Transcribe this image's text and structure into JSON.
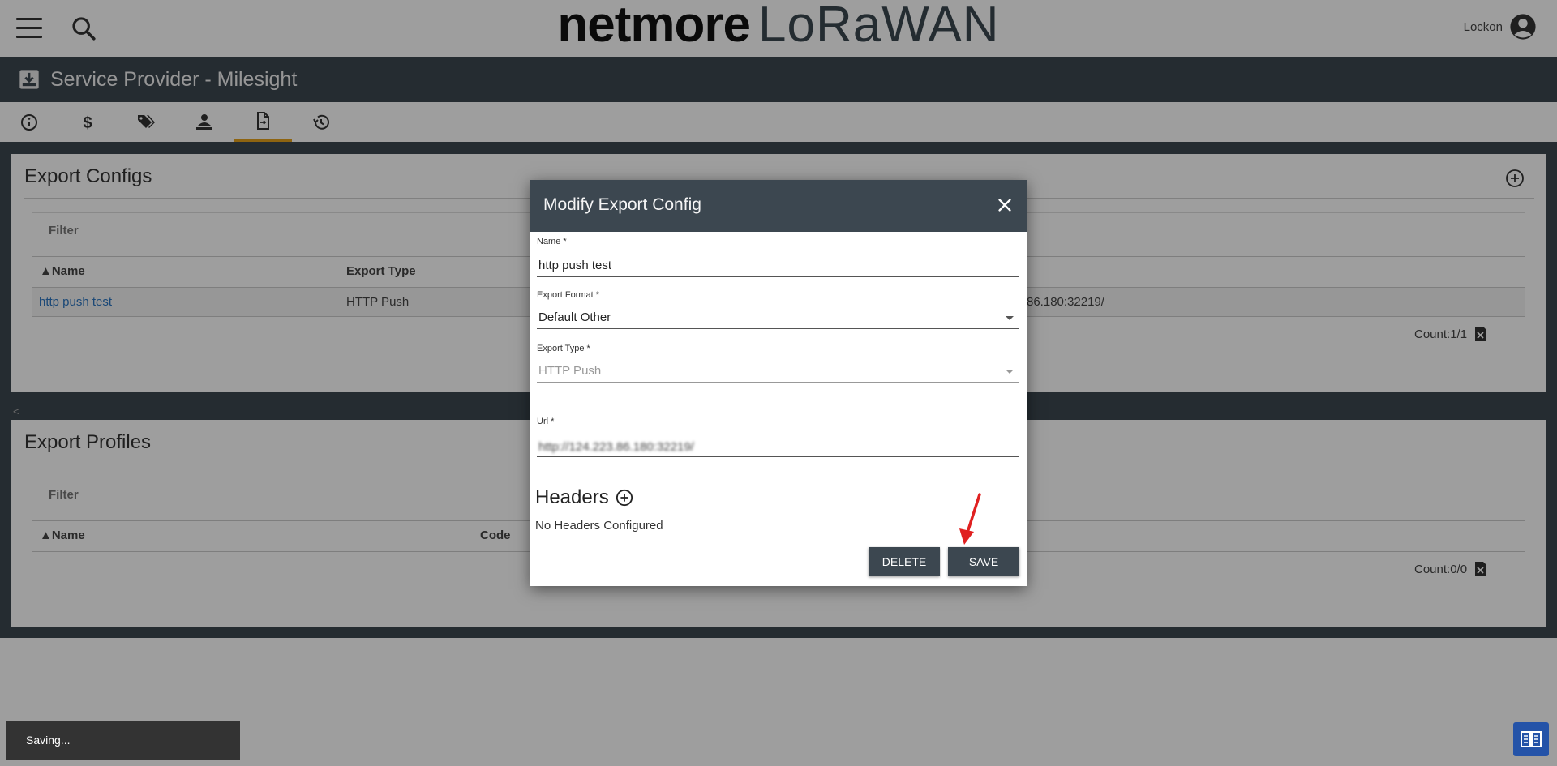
{
  "brand": {
    "part1": "netmore",
    "part2": "LoRaWAN"
  },
  "user": {
    "name": "Lockon"
  },
  "header": {
    "title": "Service Provider - Milesight"
  },
  "tabs": [
    {
      "icon": "info-icon"
    },
    {
      "icon": "dollar-icon"
    },
    {
      "icon": "tags-icon"
    },
    {
      "icon": "person-icon"
    },
    {
      "icon": "document-export-icon",
      "active": true
    },
    {
      "icon": "history-icon"
    }
  ],
  "export_configs": {
    "title": "Export Configs",
    "filter": "Filter",
    "columns": [
      "▲Name",
      "Export Type"
    ],
    "rows": [
      {
        "name": "http push test",
        "type": "HTTP Push",
        "url_tail": "86.180:32219/"
      }
    ],
    "count": "Count:1/1"
  },
  "export_profiles": {
    "title": "Export Profiles",
    "filter": "Filter",
    "columns": [
      "▲Name",
      "Code"
    ],
    "count": "Count:0/0"
  },
  "collapse_marker": "<",
  "modal": {
    "title": "Modify Export Config",
    "name_label": "Name *",
    "name_value": "http push test",
    "format_label": "Export Format *",
    "format_value": "Default Other",
    "type_label": "Export Type *",
    "type_value": "HTTP Push",
    "url_label": "Url *",
    "url_value": "http://124.223.86.180:32219/",
    "headers_title": "Headers",
    "no_headers": "No Headers Configured",
    "delete_label": "DELETE",
    "save_label": "SAVE"
  },
  "snackbar": {
    "text": "Saving..."
  },
  "colors": {
    "header_bg": "#3c4750",
    "accent_tab": "#e6a21b",
    "link": "#2a74c0",
    "help_button": "#2453a8",
    "arrow": "#e02020"
  }
}
